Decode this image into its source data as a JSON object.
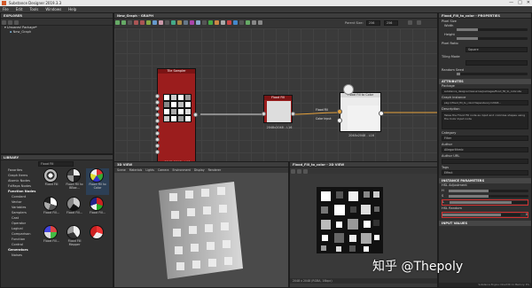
{
  "app": {
    "title": "Substance Designer 2019.3.3",
    "window_buttons": [
      "—",
      "□",
      "✕"
    ]
  },
  "menu": [
    "File",
    "Edit",
    "Tools",
    "Windows",
    "Help"
  ],
  "explorer": {
    "title": "EXPLORER",
    "package": "Unsaved Package*",
    "graph": "New_Graph"
  },
  "library": {
    "title": "LIBRARY",
    "search": "Flood Fill",
    "categories": [
      "Favorites",
      "Graph Items",
      "Atomic Nodes",
      "FxMaps Nodes",
      "Function Nodes",
      "Constant",
      "Vector",
      "Variables",
      "Samplers",
      "Cast",
      "Operator",
      "Logical",
      "Comparison",
      "Function",
      "Control",
      "Generators",
      "Noises"
    ],
    "thumbs": [
      "Flood Fill",
      "Flood Fill to BBox...",
      "Flood Fill to Color",
      "Flood Fill...",
      "Flood Fill...",
      "Flood Fill...",
      "Flood Fill...",
      "Flood Fill Mapper",
      ""
    ]
  },
  "graph": {
    "tab": "New_Graph - GRAPH",
    "params": {
      "parent_size": "Parent Size:",
      "size_value": "256",
      "size_value2": "256"
    },
    "nodes": {
      "tile": {
        "title": "Tile Sampler",
        "caption": "2048x2048 - L16"
      },
      "flood": {
        "title": "Flood Fill",
        "caption": "2048x2048 - L16"
      },
      "toColor": {
        "title": "Flood Fill to Color",
        "caption": "2048x2048 - L16",
        "ports": [
          "Flood Fill",
          "Color Input"
        ]
      }
    }
  },
  "view3d": {
    "tab": "3D VIEW",
    "menu": [
      "Scene",
      "Materials",
      "Lights",
      "Camera",
      "Environment",
      "Display",
      "Renderer"
    ]
  },
  "view2d": {
    "tab": "Flood_Fill_to_color - 2D VIEW",
    "status": "2048 x 2048 (RGBA, 16bpc)"
  },
  "props": {
    "tab": "Flood_Fill_to_color - PROPERTIES",
    "rows": [
      {
        "label": "Pixel Size",
        "sub": "Width",
        "value": ""
      },
      {
        "label": "",
        "sub": "Height",
        "value": ""
      },
      {
        "label": "Pixel Ratio",
        "sub": "",
        "value": "Square"
      },
      {
        "label": "Tiling Mode",
        "sub": "",
        "value": ""
      },
      {
        "label": "Random Seed",
        "sub": "",
        "value": "0"
      }
    ],
    "attributes": "ATTRIBUTES",
    "package_label": "Package",
    "package_value": "substance_designer/resources/packages/flood_fill_to_color.sbs",
    "graph_instance_label": "Graph instance",
    "graph_instance_value": "pkg:///flood_fill_to_color?dependency=2018...",
    "description_label": "Description",
    "description": "Takes the Flood Fill node as input and colorizes shapes using the Color Input node",
    "category_label": "Category",
    "category": "Filter",
    "author_label": "Author",
    "author": "Allegorithmic",
    "author_url_label": "Author URL",
    "tags_label": "Tags",
    "tags": "Effect",
    "instance_params": "INSTANCE PARAMETERS",
    "hsl_adj": "HSL Adjustment",
    "hsl_rows": [
      "H",
      "S",
      "L"
    ],
    "hsl_random": "HSL Random",
    "hsl_random_value": "0",
    "input_values": "INPUT VALUES",
    "footer": "Substance Engine: Direct3D 11 Memory: 6%"
  },
  "watermark": "知乎 @Thepoly"
}
